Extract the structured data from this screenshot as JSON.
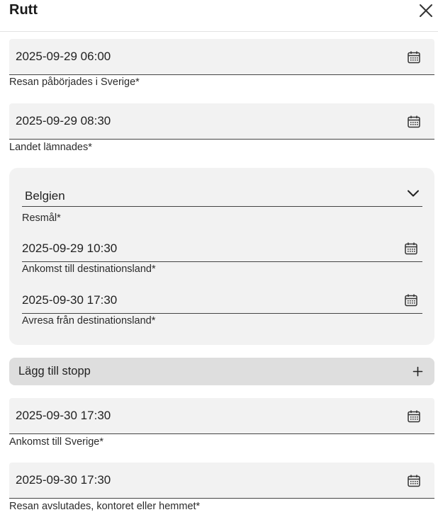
{
  "header": {
    "title": "Rutt",
    "close_icon": "close-icon"
  },
  "fields": {
    "trip_start": {
      "value": "2025-09-29 06:00",
      "label": "Resan påbörjades i Sverige*"
    },
    "country_left": {
      "value": "2025-09-29 08:30",
      "label": "Landet lämnades*"
    },
    "arrival_sweden": {
      "value": "2025-09-30 17:30",
      "label": "Ankomst till Sverige*"
    },
    "trip_end": {
      "value": "2025-09-30 17:30",
      "label": "Resan avslutades, kontoret eller hemmet*"
    }
  },
  "destination": {
    "country": {
      "value": "Belgien",
      "label": "Resmål*"
    },
    "arrival": {
      "value": "2025-09-29 10:30",
      "label": "Ankomst till destinationsland*"
    },
    "departure": {
      "value": "2025-09-30 17:30",
      "label": "Avresa från destinationsland*"
    }
  },
  "add_stop": {
    "label": "Lägg till stopp",
    "icon": "plus-icon"
  },
  "icons": {
    "calendar": "calendar-icon",
    "chevron": "chevron-down-icon"
  },
  "colors": {
    "field_bg": "#f2f2f2",
    "button_bg": "#dedede",
    "underline": "#444444"
  }
}
